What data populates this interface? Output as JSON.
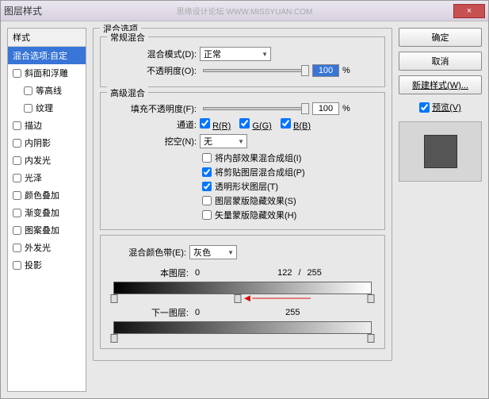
{
  "title": "图层样式",
  "watermark": "思缘设计论坛  WWW.MISSYUAN.COM",
  "close": "×",
  "left": {
    "head": "样式",
    "selected": "混合选项:自定",
    "items": [
      {
        "label": "斜面和浮雕",
        "indent": 0
      },
      {
        "label": "等高线",
        "indent": 1
      },
      {
        "label": "纹理",
        "indent": 1
      },
      {
        "label": "描边",
        "indent": 0
      },
      {
        "label": "内阴影",
        "indent": 0
      },
      {
        "label": "内发光",
        "indent": 0
      },
      {
        "label": "光泽",
        "indent": 0
      },
      {
        "label": "颜色叠加",
        "indent": 0
      },
      {
        "label": "渐变叠加",
        "indent": 0
      },
      {
        "label": "图案叠加",
        "indent": 0
      },
      {
        "label": "外发光",
        "indent": 0
      },
      {
        "label": "投影",
        "indent": 0
      }
    ]
  },
  "center": {
    "group": "混合选项",
    "sub1": {
      "title": "常规混合",
      "mode_label": "混合模式(D):",
      "mode_value": "正常",
      "opacity_label": "不透明度(O):",
      "opacity_value": "100",
      "pct": "%"
    },
    "sub2": {
      "title": "高级混合",
      "fill_label": "填充不透明度(F):",
      "fill_value": "100",
      "pct": "%",
      "channel_label": "通道:",
      "r": "R(R)",
      "g": "G(G)",
      "b": "B(B)",
      "knockout_label": "挖空(N):",
      "knockout_value": "无",
      "c1": "将内部效果混合成组(I)",
      "c2": "将剪贴图层混合成组(P)",
      "c3": "透明形状图层(T)",
      "c4": "图层蒙版隐藏效果(S)",
      "c5": "矢量蒙版隐藏效果(H)"
    },
    "blend_if": {
      "label": "混合颜色带(E):",
      "value": "灰色",
      "this_label": "本图层:",
      "this_v1": "0",
      "this_v2": "122",
      "this_sep": "/",
      "this_v3": "255",
      "under_label": "下一图层:",
      "under_v1": "0",
      "under_v2": "255"
    }
  },
  "right": {
    "ok": "确定",
    "cancel": "取消",
    "newstyle": "新建样式(W)...",
    "preview_label": "预览(V)"
  }
}
